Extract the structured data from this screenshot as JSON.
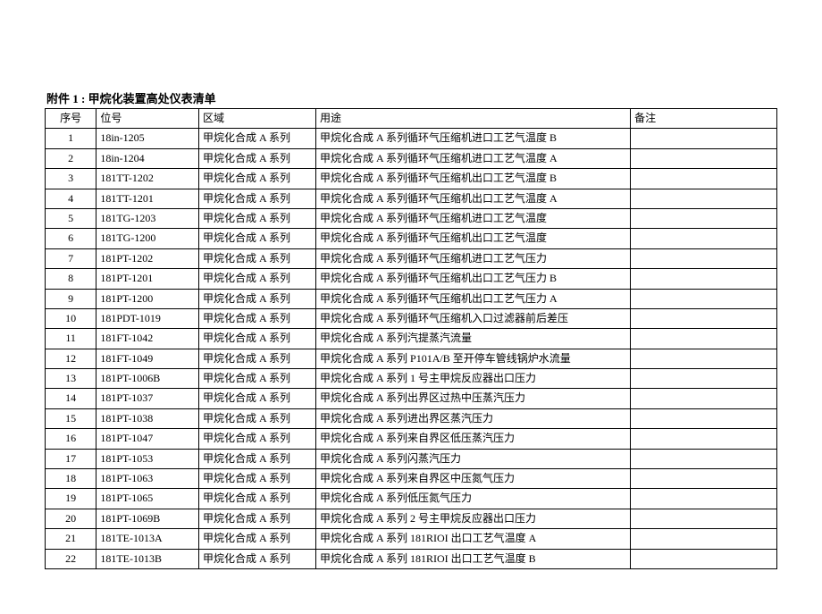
{
  "title": "附件 1 : 甲烷化装置高处仪表清单",
  "headers": {
    "seq": "序号",
    "tag": "位号",
    "area": "区域",
    "use": "用途",
    "note": "备注"
  },
  "rows": [
    {
      "seq": "1",
      "tag": "18in-1205",
      "area": "甲烷化合成 A 系列",
      "use": "甲烷化合成 A 系列循环气压缩机进口工艺气温度 B",
      "note": ""
    },
    {
      "seq": "2",
      "tag": "18in-1204",
      "area": "甲烷化合成 A 系列",
      "use": "甲烷化合成 A 系列循环气压缩机进口工艺气温度 A",
      "note": ""
    },
    {
      "seq": "3",
      "tag": "181TT-1202",
      "area": "甲烷化合成 A 系列",
      "use": "甲烷化合成 A 系列循环气压缩机出口工艺气温度 B",
      "note": ""
    },
    {
      "seq": "4",
      "tag": "181TT-1201",
      "area": "甲烷化合成 A 系列",
      "use": "甲烷化合成 A 系列循环气压缩机出口工艺气温度 A",
      "note": ""
    },
    {
      "seq": "5",
      "tag": "181TG-1203",
      "area": "甲烷化合成 A 系列",
      "use": "甲烷化合成 A 系列循环气压缩机进口工艺气温度",
      "note": ""
    },
    {
      "seq": "6",
      "tag": "181TG-1200",
      "area": "甲烷化合成 A 系列",
      "use": "甲烷化合成 A 系列循环气压缩机出口工艺气温度",
      "note": ""
    },
    {
      "seq": "7",
      "tag": "181PT-1202",
      "area": "甲烷化合成 A 系列",
      "use": "甲烷化合成 A 系列循环气压缩机进口工艺气压力",
      "note": ""
    },
    {
      "seq": "8",
      "tag": "181PT-1201",
      "area": "甲烷化合成 A 系列",
      "use": "甲烷化合成 A 系列循环气压缩机出口工艺气压力 B",
      "note": ""
    },
    {
      "seq": "9",
      "tag": "181PT-1200",
      "area": "甲烷化合成 A 系列",
      "use": "甲烷化合成 A 系列循环气压缩机出口工艺气压力 A",
      "note": ""
    },
    {
      "seq": "10",
      "tag": "181PDT-1019",
      "area": "甲烷化合成 A 系列",
      "use": "甲烷化合成 A 系列循环气压缩机入口过滤器前后差压",
      "note": ""
    },
    {
      "seq": "11",
      "tag": "181FT-1042",
      "area": "甲烷化合成 A 系列",
      "use": "甲烷化合成 A 系列汽提蒸汽流量",
      "note": ""
    },
    {
      "seq": "12",
      "tag": "181FT-1049",
      "area": "甲烷化合成 A 系列",
      "use": "甲烷化合成 A 系列 P101A/B 至开停车管线锅炉水流量",
      "note": ""
    },
    {
      "seq": "13",
      "tag": "181PT-1006B",
      "area": "甲烷化合成 A 系列",
      "use": "甲烷化合成 A 系列 1 号主甲烷反应器出口压力",
      "note": ""
    },
    {
      "seq": "14",
      "tag": "181PT-1037",
      "area": "甲烷化合成 A 系列",
      "use": "甲烷化合成 A 系列出界区过热中压蒸汽压力",
      "note": ""
    },
    {
      "seq": "15",
      "tag": "181PT-1038",
      "area": "甲烷化合成 A 系列",
      "use": "甲烷化合成 A 系列进出界区蒸汽压力",
      "note": ""
    },
    {
      "seq": "16",
      "tag": "181PT-1047",
      "area": "甲烷化合成 A 系列",
      "use": "甲烷化合成 A 系列来自界区低压蒸汽压力",
      "note": ""
    },
    {
      "seq": "17",
      "tag": "181PT-1053",
      "area": "甲烷化合成 A 系列",
      "use": "甲烷化合成 A 系列闪蒸汽压力",
      "note": ""
    },
    {
      "seq": "18",
      "tag": "181PT-1063",
      "area": "甲烷化合成 A 系列",
      "use": "甲烷化合成 A 系列来自界区中压氮气压力",
      "note": ""
    },
    {
      "seq": "19",
      "tag": "181PT-1065",
      "area": "甲烷化合成 A 系列",
      "use": "甲烷化合成 A 系列低压氮气压力",
      "note": ""
    },
    {
      "seq": "20",
      "tag": "181PT-1069B",
      "area": "甲烷化合成 A 系列",
      "use": "甲烷化合成 A 系列 2 号主甲烷反应器出口压力",
      "note": ""
    },
    {
      "seq": "21",
      "tag": "181TE-1013A",
      "area": "甲烷化合成 A 系列",
      "use": "甲烷化合成 A 系列 181RIOI 出口工艺气温度 A",
      "note": ""
    },
    {
      "seq": "22",
      "tag": "181TE-1013B",
      "area": "甲烷化合成 A 系列",
      "use": "甲烷化合成 A 系列 181RIOI 出口工艺气温度 B",
      "note": ""
    }
  ]
}
